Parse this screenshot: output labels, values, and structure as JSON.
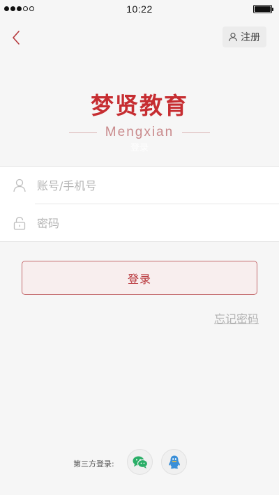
{
  "status_bar": {
    "time": "10:22",
    "signal_strength": 3,
    "signal_total": 5,
    "battery_level": 1.0,
    "icons": [
      "signal-dots-icon",
      "battery-icon"
    ]
  },
  "header": {
    "back_icon": "chevron-left-icon",
    "register_icon": "person-icon",
    "register_label": "注册"
  },
  "brand": {
    "title": "梦贤教育",
    "subtitle": "Mengxian",
    "overlay_text": "登录"
  },
  "form": {
    "account": {
      "icon": "person-icon",
      "placeholder": "账号/手机号",
      "value": ""
    },
    "password": {
      "icon": "lock-icon",
      "placeholder": "密码",
      "value": ""
    }
  },
  "actions": {
    "login_label": "登录",
    "forgot_label": "忘记密码"
  },
  "third_party": {
    "label": "第三方登录:",
    "providers": [
      {
        "name": "wechat",
        "icon": "wechat-icon",
        "color": "#2aae67"
      },
      {
        "name": "qq",
        "icon": "qq-penguin-icon",
        "color": "#3a8fd8"
      }
    ]
  },
  "colors": {
    "brand_red": "#c62d31",
    "background": "#f6f6f6",
    "button_border": "#c46b6e"
  }
}
